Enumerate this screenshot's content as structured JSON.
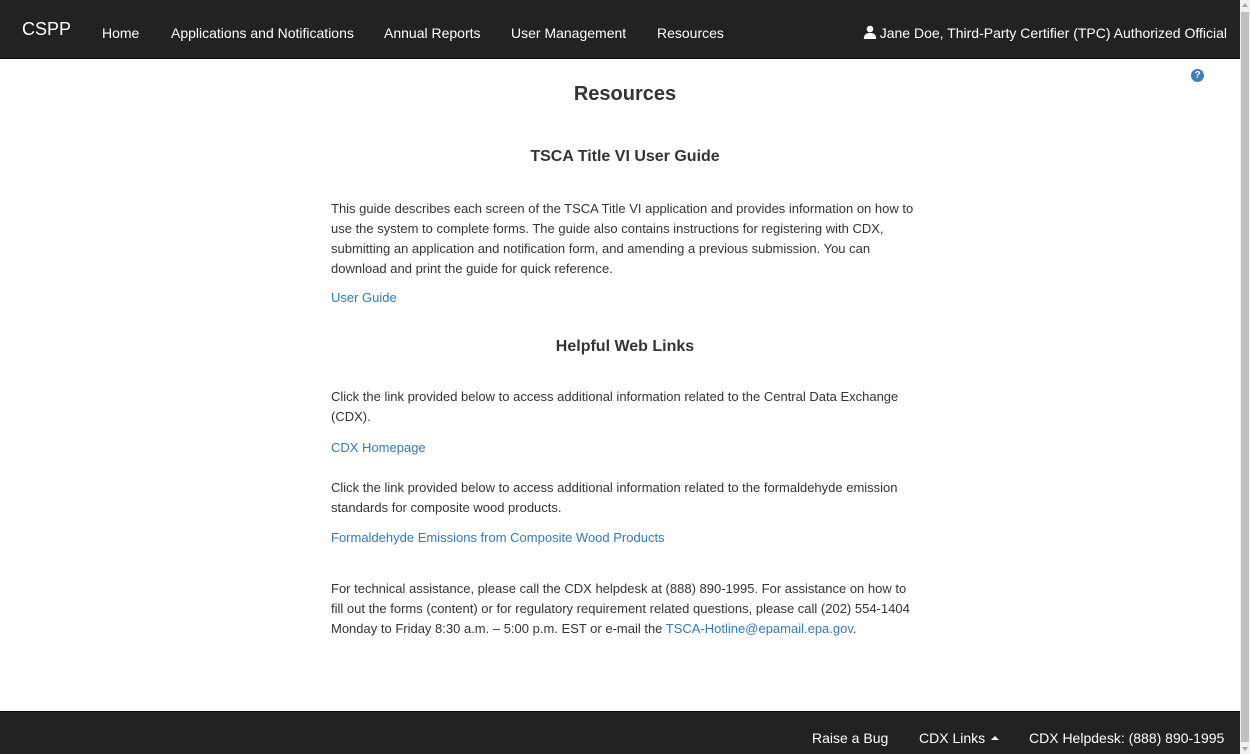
{
  "navbar": {
    "brand": "CSPP",
    "items": [
      {
        "label": "Home"
      },
      {
        "label": "Applications and Notifications"
      },
      {
        "label": "Annual Reports"
      },
      {
        "label": "User Management"
      },
      {
        "label": "Resources"
      }
    ],
    "user_label": "Jane Doe, Third-Party Certifier (TPC) Authorized Official",
    "user_icon": "user-icon"
  },
  "help_icon": {
    "glyph": "?",
    "icon": "question-circle-icon",
    "color": "#3d7ebf"
  },
  "main": {
    "title": "Resources",
    "guide_section": {
      "heading": "TSCA Title VI User Guide",
      "description": "This guide describes each screen of the TSCA Title VI application and provides information on how to use the system to complete forms. The guide also contains instructions for registering with CDX, submitting an application and notification form, and amending a previous submission. You can download and print the guide for quick reference.",
      "link_label": "User Guide"
    },
    "links_section": {
      "heading": "Helpful Web Links",
      "cdx_text": "Click the link provided below to access additional information related to the Central Data Exchange (CDX).",
      "cdx_link": "CDX Homepage",
      "formaldehyde_text": "Click the link provided below to access additional information related to the formaldehyde emission standards for composite wood products.",
      "formaldehyde_link": "Formaldehyde Emissions from Composite Wood Products",
      "tech_text": "For technical assistance, please call the CDX helpdesk at (888) 890-1995. For assistance on how to fill out the forms (content) or for regulatory requirement related questions, please call (202) 554-1404 Monday to Friday 8:30 a.m. – 5:00 p.m. EST or e-mail the ",
      "hotline_email": "TSCA-Hotline@epamail.epa.gov",
      "tech_text_end": "."
    }
  },
  "footer": {
    "raise_bug": "Raise a Bug",
    "cdx_links": "CDX Links",
    "helpdesk": "CDX Helpdesk: (888) 890-1995"
  },
  "colors": {
    "navbar_bg": "#222222",
    "link": "#337ab7",
    "text": "#333333"
  }
}
